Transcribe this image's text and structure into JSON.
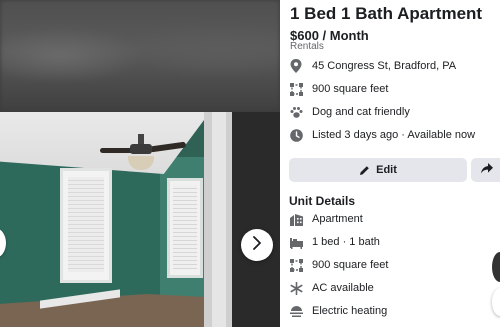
{
  "listing": {
    "title": "1 Bed 1 Bath Apartment",
    "price": "$600 / Month",
    "category": "Rentals"
  },
  "details": [
    {
      "icon": "location-pin-icon",
      "text": "45 Congress St, Bradford, PA"
    },
    {
      "icon": "area-icon",
      "text": "900 square feet"
    },
    {
      "icon": "paw-icon",
      "text": "Dog and cat friendly"
    },
    {
      "icon": "clock-icon",
      "text": "Listed 3 days ago · Available now"
    }
  ],
  "actions": {
    "edit_label": "Edit",
    "share_icon": "share-arrow-icon"
  },
  "unit_details": {
    "title": "Unit Details",
    "items": [
      {
        "icon": "building-icon",
        "text": "Apartment"
      },
      {
        "icon": "bed-bath-icon",
        "text": "1 bed · 1 bath"
      },
      {
        "icon": "area-icon",
        "text": "900 square feet"
      },
      {
        "icon": "snowflake-icon",
        "text": "AC available"
      },
      {
        "icon": "heating-icon",
        "text": "Electric heating"
      }
    ]
  },
  "viewer": {
    "prev_icon": "chevron-left-icon",
    "next_icon": "chevron-right-icon"
  },
  "colors": {
    "text": "#1c1e21",
    "secondary_text": "#65676b",
    "button_bg": "#e4e6eb",
    "icon": "#65676b"
  }
}
